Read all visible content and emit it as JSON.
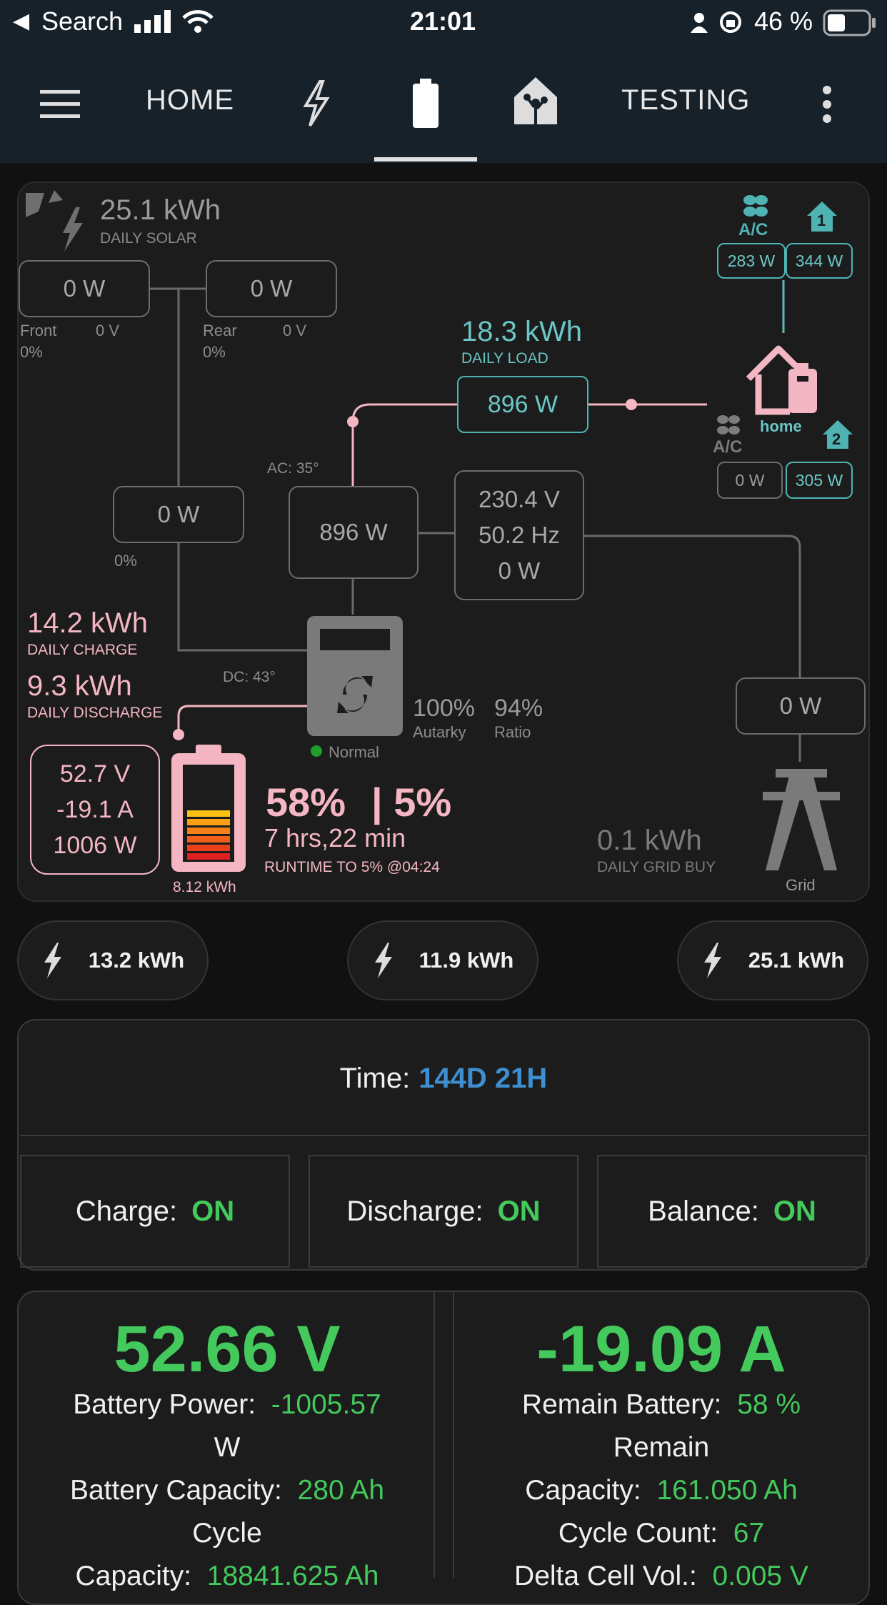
{
  "status_bar": {
    "back_label": "Search",
    "time": "21:01",
    "battery_pct": "46 %"
  },
  "nav": {
    "home": "HOME",
    "testing": "TESTING"
  },
  "flow": {
    "solar": {
      "value": "25.1 kWh",
      "label": "DAILY SOLAR"
    },
    "pv_front": {
      "power": "0 W",
      "name": "Front",
      "voltage": "0 V",
      "pct": "0%"
    },
    "pv_rear": {
      "power": "0 W",
      "name": "Rear",
      "voltage": "0 V",
      "pct": "0%"
    },
    "ac_loads": {
      "ac_label": "A/C",
      "load1": "283 W",
      "load2": "344 W",
      "house1": "1",
      "house2": "2",
      "load3": "0 W",
      "load4": "305 W",
      "home_label": "home"
    },
    "load": {
      "value": "18.3 kWh",
      "label": "DAILY LOAD",
      "power": "896 W"
    },
    "ac_temp": "AC: 35°",
    "inverter_out": "896 W",
    "grid_stats": {
      "voltage": "230.4 V",
      "freq": "50.2 Hz",
      "power": "0 W"
    },
    "aux": {
      "power": "0 W",
      "pct": "0%"
    },
    "charge": {
      "value": "14.2 kWh",
      "label": "DAILY CHARGE"
    },
    "discharge": {
      "value": "9.3 kWh",
      "label": "DAILY DISCHARGE"
    },
    "dc_temp": "DC: 43°",
    "inverter_status": "Normal",
    "autarky": {
      "value": "100%",
      "label": "Autarky"
    },
    "ratio": {
      "value": "94%",
      "label": "Ratio"
    },
    "grid_power": "0 W",
    "battery": {
      "voltage": "52.7 V",
      "current": "-19.1 A",
      "power": "1006 W",
      "energy": "8.12 kWh",
      "soc": "58%",
      "min_soc": "| 5%",
      "runtime": "7 hrs,22 min",
      "runtime_label": "RUNTIME TO 5% @04:24",
      "fill_fraction": 0.58
    },
    "grid_buy": {
      "value": "0.1 kWh",
      "label": "DAILY GRID BUY"
    },
    "grid_label": "Grid",
    "colors": {
      "teal": "#5fb8b8",
      "pink": "#f4b6c2",
      "gray": "#8c8c8c"
    }
  },
  "pills": [
    "13.2 kWh",
    "11.9 kWh",
    "25.1 kWh"
  ],
  "bms": {
    "time_label": "Time:",
    "time_value": "144D 21H",
    "charge_label": "Charge:",
    "charge_value": "ON",
    "discharge_label": "Discharge:",
    "discharge_value": "ON",
    "balance_label": "Balance:",
    "balance_value": "ON"
  },
  "stats": {
    "voltage": "52.66 V",
    "current": "-19.09 A",
    "left": {
      "power_label": "Battery Power:",
      "power_value": "-1005.57",
      "power_unit": "W",
      "capacity_label": "Battery Capacity:",
      "capacity_value": "280 Ah",
      "cycle_label": "Cycle",
      "cycle_cap_label": "Capacity:",
      "cycle_cap_value": "18841.625 Ah"
    },
    "right": {
      "remain_label": "Remain Battery:",
      "remain_value": "58 %",
      "remain_cap_label1": "Remain",
      "remain_cap_label2": "Capacity:",
      "remain_cap_value": "161.050 Ah",
      "cycle_count_label": "Cycle Count:",
      "cycle_count_value": "67",
      "delta_label": "Delta Cell Vol.:",
      "delta_value": "0.005 V"
    }
  }
}
